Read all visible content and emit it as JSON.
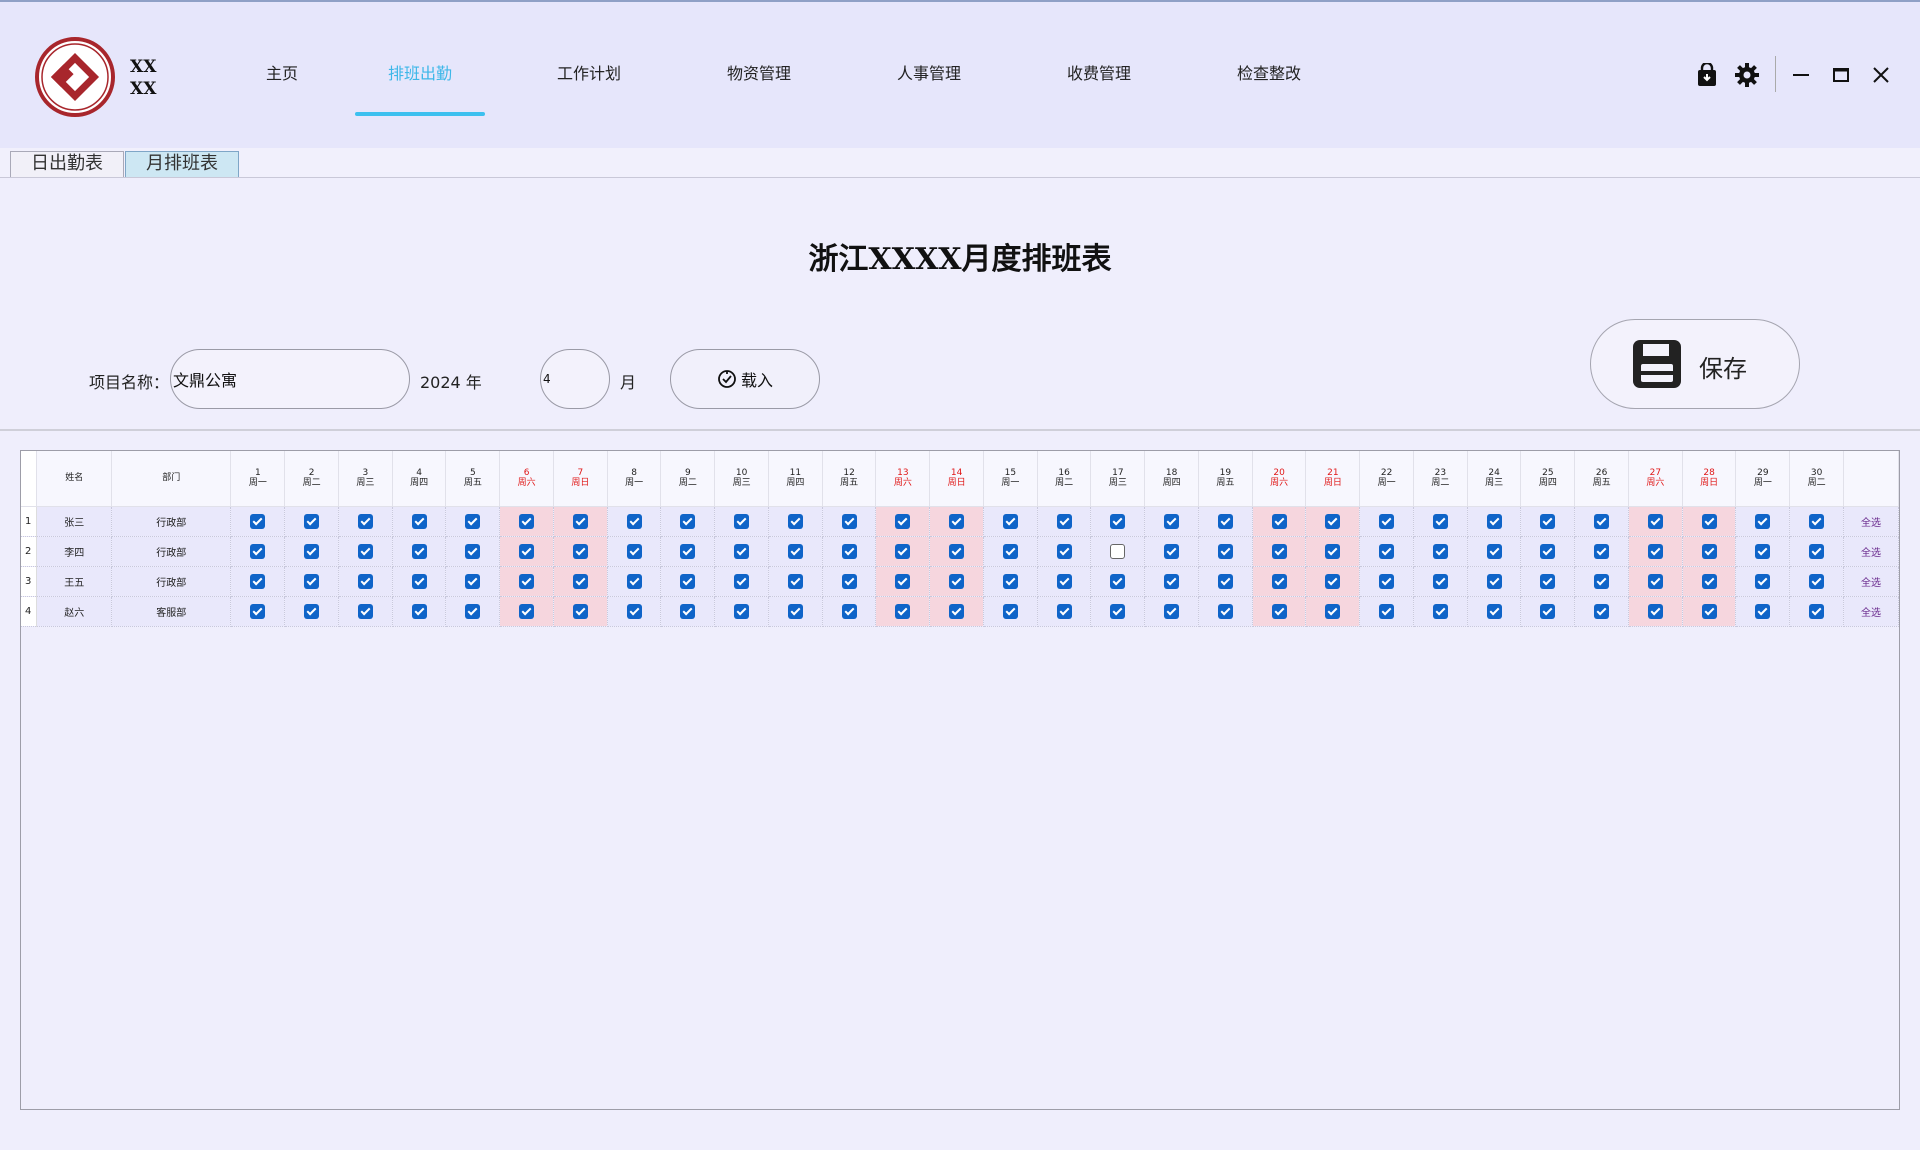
{
  "brand": {
    "line1": "XX",
    "line2": "XX"
  },
  "nav": {
    "items": [
      {
        "label": "主页",
        "active": false
      },
      {
        "label": "排班出勤",
        "active": true
      },
      {
        "label": "工作计划",
        "active": false
      },
      {
        "label": "物资管理",
        "active": false
      },
      {
        "label": "人事管理",
        "active": false
      },
      {
        "label": "收费管理",
        "active": false
      },
      {
        "label": "检查整改",
        "active": false
      }
    ]
  },
  "window_controls": [
    "lock-icon",
    "gear-icon",
    "minimize-icon",
    "maximize-icon",
    "close-icon"
  ],
  "tabs": [
    {
      "label": "日出勤表",
      "active": false
    },
    {
      "label": "月排班表",
      "active": true
    }
  ],
  "page_title": "浙江XXXX月度排班表",
  "filters": {
    "project_label": "项目名称：",
    "project_value": "文鼎公寓",
    "year_text": "2024 年",
    "month_value": "4",
    "month_unit": "月",
    "load_label": "载入",
    "save_label": "保存"
  },
  "colors": {
    "accent": "#3db7e8",
    "checkbox": "#0f64c8",
    "weekend_bg": "#f6d6de",
    "weekend_text": "#e01818"
  },
  "table": {
    "name_header": "姓名",
    "dept_header": "部门",
    "days": [
      {
        "d": "1",
        "w": "周一",
        "weekend": false
      },
      {
        "d": "2",
        "w": "周二",
        "weekend": false
      },
      {
        "d": "3",
        "w": "周三",
        "weekend": false
      },
      {
        "d": "4",
        "w": "周四",
        "weekend": false
      },
      {
        "d": "5",
        "w": "周五",
        "weekend": false
      },
      {
        "d": "6",
        "w": "周六",
        "weekend": true
      },
      {
        "d": "7",
        "w": "周日",
        "weekend": true
      },
      {
        "d": "8",
        "w": "周一",
        "weekend": false
      },
      {
        "d": "9",
        "w": "周二",
        "weekend": false
      },
      {
        "d": "10",
        "w": "周三",
        "weekend": false
      },
      {
        "d": "11",
        "w": "周四",
        "weekend": false
      },
      {
        "d": "12",
        "w": "周五",
        "weekend": false
      },
      {
        "d": "13",
        "w": "周六",
        "weekend": true
      },
      {
        "d": "14",
        "w": "周日",
        "weekend": true
      },
      {
        "d": "15",
        "w": "周一",
        "weekend": false
      },
      {
        "d": "16",
        "w": "周二",
        "weekend": false
      },
      {
        "d": "17",
        "w": "周三",
        "weekend": false
      },
      {
        "d": "18",
        "w": "周四",
        "weekend": false
      },
      {
        "d": "19",
        "w": "周五",
        "weekend": false
      },
      {
        "d": "20",
        "w": "周六",
        "weekend": true
      },
      {
        "d": "21",
        "w": "周日",
        "weekend": true
      },
      {
        "d": "22",
        "w": "周一",
        "weekend": false
      },
      {
        "d": "23",
        "w": "周二",
        "weekend": false
      },
      {
        "d": "24",
        "w": "周三",
        "weekend": false
      },
      {
        "d": "25",
        "w": "周四",
        "weekend": false
      },
      {
        "d": "26",
        "w": "周五",
        "weekend": false
      },
      {
        "d": "27",
        "w": "周六",
        "weekend": true
      },
      {
        "d": "28",
        "w": "周日",
        "weekend": true
      },
      {
        "d": "29",
        "w": "周一",
        "weekend": false
      },
      {
        "d": "30",
        "w": "周二",
        "weekend": false
      }
    ],
    "rows": [
      {
        "num": "1",
        "name": "张三",
        "dept": "行政部",
        "unchecked": [],
        "select_all": "全选"
      },
      {
        "num": "2",
        "name": "李四",
        "dept": "行政部",
        "unchecked": [
          17
        ],
        "select_all": "全选"
      },
      {
        "num": "3",
        "name": "王五",
        "dept": "行政部",
        "unchecked": [],
        "select_all": "全选"
      },
      {
        "num": "4",
        "name": "赵六",
        "dept": "客服部",
        "unchecked": [],
        "select_all": "全选"
      }
    ]
  }
}
